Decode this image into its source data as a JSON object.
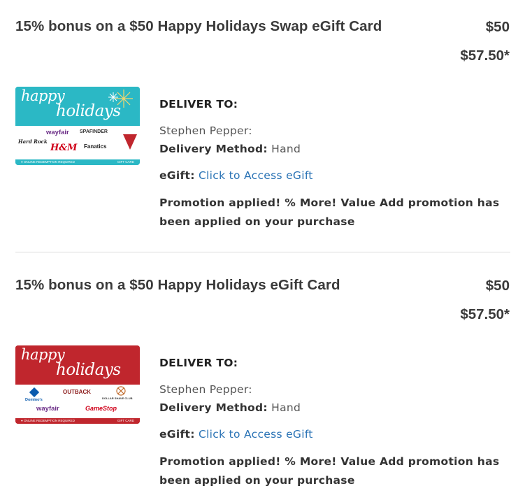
{
  "items": [
    {
      "title": "15% bonus on a $50 Happy Holidays Swap eGift Card",
      "price_original": "$50",
      "price_bonus": "$57.50*",
      "card": {
        "color": "#2bb8c5",
        "happy": "happy",
        "holidays": "holidays",
        "logos": [
          "Hard Rock",
          "wayfair",
          "SPAFINDER",
          "H&M",
          "Fanatics"
        ],
        "footer_left": "● ONLINE REDEMPTION REQUIRED",
        "footer_right": "GIFT CARD"
      },
      "deliver_label": "DELIVER TO:",
      "recipient": "Stephen Pepper:",
      "delivery_method_label": "Delivery Method:",
      "delivery_method_value": "Hand",
      "egift_label": "eGift:",
      "egift_link": "Click to Access eGift",
      "promo_text": "Promotion applied! % More! Value Add promotion has been applied on your purchase"
    },
    {
      "title": "15% bonus on a $50 Happy Holidays eGift Card",
      "price_original": "$50",
      "price_bonus": "$57.50*",
      "card": {
        "color": "#c0262d",
        "happy": "happy",
        "holidays": "holidays",
        "logos": [
          "Domino's",
          "OUTBACK",
          "DOLLAR SHAVE CLUB",
          "wayfair",
          "GameStop"
        ],
        "footer_left": "● ONLINE REDEMPTION REQUIRED",
        "footer_right": "GIFT CARD"
      },
      "deliver_label": "DELIVER TO:",
      "recipient": "Stephen Pepper:",
      "delivery_method_label": "Delivery Method:",
      "delivery_method_value": "Hand",
      "egift_label": "eGift:",
      "egift_link": "Click to Access eGift",
      "promo_text": "Promotion applied! % More! Value Add promotion has been applied on your purchase"
    }
  ]
}
